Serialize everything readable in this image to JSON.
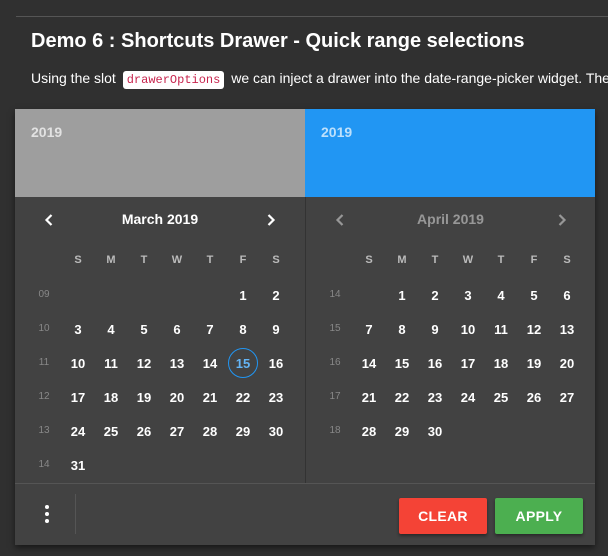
{
  "demo": {
    "title": "Demo 6 : Shortcuts Drawer - Quick range selections",
    "desc_before": "Using the slot",
    "code": "drawerOptions",
    "desc_after": "we can inject a drawer into the date-range-picker widget. The"
  },
  "picker": {
    "left_header": {
      "year": "2019",
      "color": "#9e9e9e"
    },
    "right_header": {
      "year": "2019",
      "color": "#2196f3"
    },
    "weekday_labels": [
      "S",
      "M",
      "T",
      "W",
      "T",
      "F",
      "S"
    ],
    "left_calendar": {
      "month": "March 2019",
      "first_weekday": 5,
      "days_in_month": 31,
      "week_numbers": [
        "09",
        "10",
        "11",
        "12",
        "13",
        "14"
      ],
      "today": 15
    },
    "right_calendar": {
      "month": "April 2019",
      "first_weekday": 1,
      "days_in_month": 30,
      "week_numbers": [
        "14",
        "15",
        "16",
        "17",
        "18"
      ]
    },
    "footer": {
      "clear_label": "CLEAR",
      "apply_label": "APPLY",
      "clear_color": "#f44336",
      "apply_color": "#4caf50",
      "menu_icon": "more-vert-icon"
    }
  }
}
